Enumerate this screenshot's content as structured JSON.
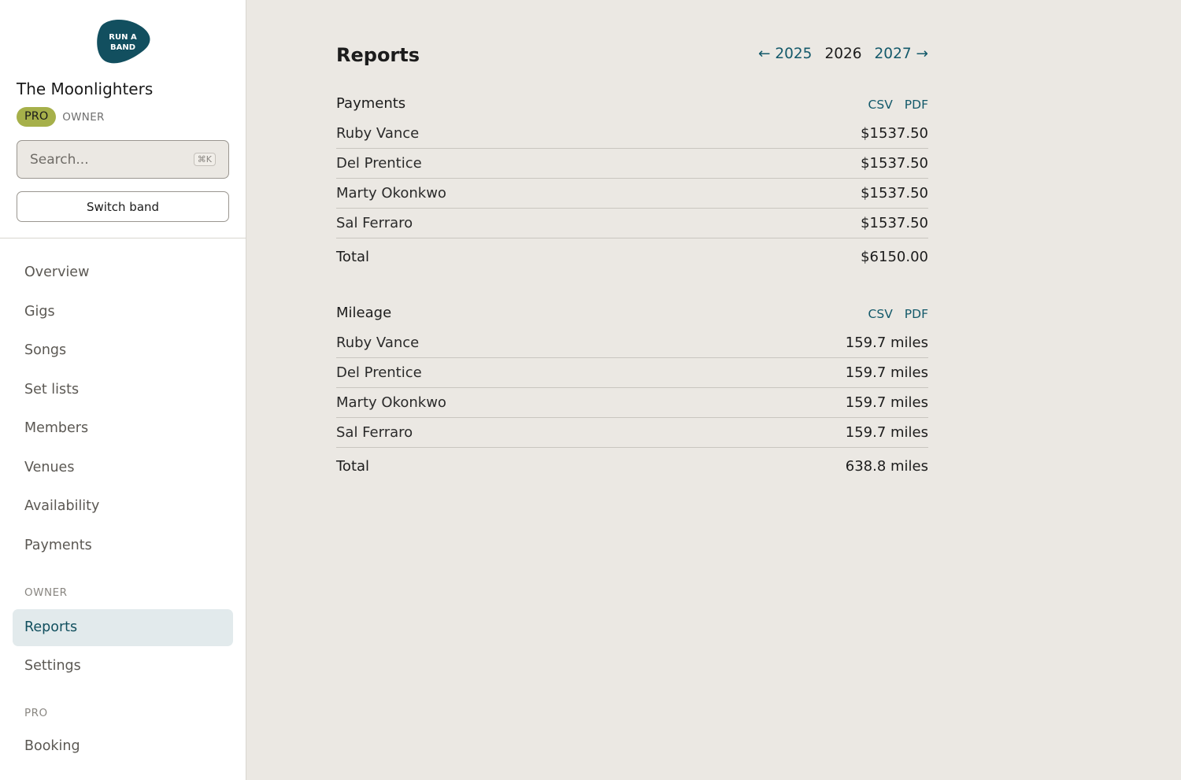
{
  "sidebar": {
    "logo_text": [
      "RUN A",
      "BAND"
    ],
    "band_name": "The Moonlighters",
    "plan_badge": "PRO",
    "role_badge": "OWNER",
    "search": {
      "placeholder": "Search...",
      "shortcut": "⌘K"
    },
    "switch_label": "Switch band",
    "nav": {
      "overview": "Overview",
      "gigs": "Gigs",
      "songs": "Songs",
      "setlists": "Set lists",
      "members": "Members",
      "venues": "Venues",
      "availability": "Availability",
      "payments": "Payments"
    },
    "owner_section": "OWNER",
    "owner_nav": {
      "reports": "Reports",
      "settings": "Settings"
    },
    "pro_section": "PRO",
    "pro_nav": {
      "booking": "Booking"
    }
  },
  "main": {
    "title": "Reports",
    "years": {
      "prev": "← 2025",
      "current": "2026",
      "next": "2027 →"
    },
    "payments": {
      "title": "Payments",
      "csv": "CSV",
      "pdf": "PDF",
      "rows": [
        {
          "name": "Ruby Vance",
          "value": "$1537.50"
        },
        {
          "name": "Del Prentice",
          "value": "$1537.50"
        },
        {
          "name": "Marty Okonkwo",
          "value": "$1537.50"
        },
        {
          "name": "Sal Ferraro",
          "value": "$1537.50"
        }
      ],
      "total_label": "Total",
      "total_value": "$6150.00"
    },
    "mileage": {
      "title": "Mileage",
      "csv": "CSV",
      "pdf": "PDF",
      "rows": [
        {
          "name": "Ruby Vance",
          "value": "159.7 miles"
        },
        {
          "name": "Del Prentice",
          "value": "159.7 miles"
        },
        {
          "name": "Marty Okonkwo",
          "value": "159.7 miles"
        },
        {
          "name": "Sal Ferraro",
          "value": "159.7 miles"
        }
      ],
      "total_label": "Total",
      "total_value": "638.8 miles"
    }
  },
  "colors": {
    "brand": "#114f5e",
    "link": "#13596a",
    "pro_badge": "#a6b04a",
    "active_nav_bg": "#e2eaec",
    "page_bg": "#ebe8e3"
  }
}
